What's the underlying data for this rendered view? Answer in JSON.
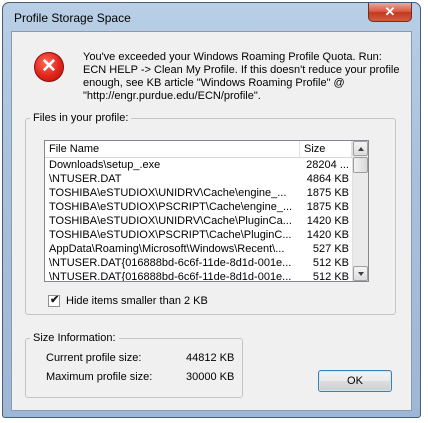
{
  "window": {
    "title": "Profile Storage Space",
    "close_glyph": "✕"
  },
  "message": {
    "icon": "error-icon",
    "icon_glyph": "✕",
    "text": "You've exceeded your Windows Roaming Profile Quota. Run:\nECN HELP -> Clean My Profile. If this doesn't  reduce your profile\nenough, see KB article \"Windows Roaming Profile\" @\n\"http://engr.purdue.edu/ECN/profile\"."
  },
  "files_group": {
    "legend": "Files in your profile:",
    "columns": {
      "name": "File Name",
      "size": "Size"
    },
    "rows": [
      {
        "name": "Downloads\\setup_.exe",
        "size": "28204 ..."
      },
      {
        "name": "\\NTUSER.DAT",
        "size": "4864 KB"
      },
      {
        "name": "TOSHIBA\\eSTUDIOX\\UNIDRV\\Cache\\engine_...",
        "size": "1875 KB"
      },
      {
        "name": "TOSHIBA\\eSTUDIOX\\PSCRIPT\\Cache\\engine_...",
        "size": "1875 KB"
      },
      {
        "name": "TOSHIBA\\eSTUDIOX\\UNIDRV\\Cache\\PluginCa...",
        "size": "1420 KB"
      },
      {
        "name": "TOSHIBA\\eSTUDIOX\\PSCRIPT\\Cache\\PluginC...",
        "size": "1420 KB"
      },
      {
        "name": "AppData\\Roaming\\Microsoft\\Windows\\Recent\\...",
        "size": "527 KB"
      },
      {
        "name": "\\NTUSER.DAT{016888bd-6c6f-11de-8d1d-001e...",
        "size": "512 KB"
      },
      {
        "name": "\\NTUSER.DAT{016888bd-6c6f-11de-8d1d-001e...",
        "size": "512 KB"
      }
    ],
    "hide_small_label": "Hide items smaller than 2 KB",
    "hide_small_checked": true,
    "check_glyph": "✔"
  },
  "size_info": {
    "legend": "Size Information:",
    "current_label": "Current profile size:",
    "current_value": "44812 KB",
    "max_label": "Maximum profile size:",
    "max_value": "30000 KB"
  },
  "buttons": {
    "ok": "OK"
  }
}
